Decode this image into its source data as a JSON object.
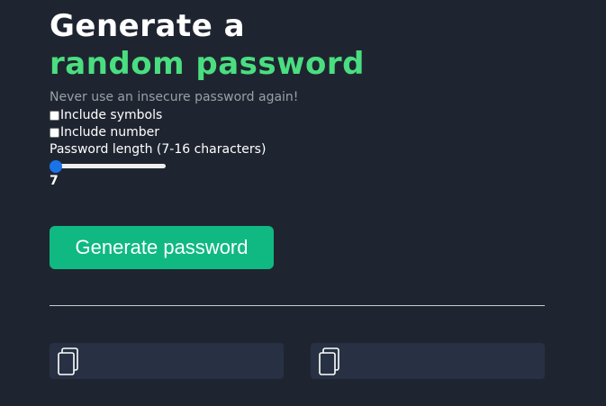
{
  "header": {
    "title_line1": "Generate a",
    "title_line2": "random password",
    "tagline": "Never use an insecure password again!"
  },
  "options": {
    "symbols": {
      "label": "Include symbols",
      "checked": false
    },
    "number": {
      "label": "Include number",
      "checked": false
    }
  },
  "length": {
    "label": "Password length (7-16 characters)",
    "value": "7",
    "min": 7,
    "max": 16
  },
  "generate_button": {
    "label": "Generate password"
  },
  "results": [
    {
      "value": "",
      "icon": "copy-icon"
    },
    {
      "value": "",
      "icon": "copy-icon"
    }
  ],
  "colors": {
    "background": "#1f2530",
    "accent_green": "#4ade80",
    "button_green": "#10b981",
    "slider_blue": "#1a73e8",
    "result_box": "#273143"
  }
}
